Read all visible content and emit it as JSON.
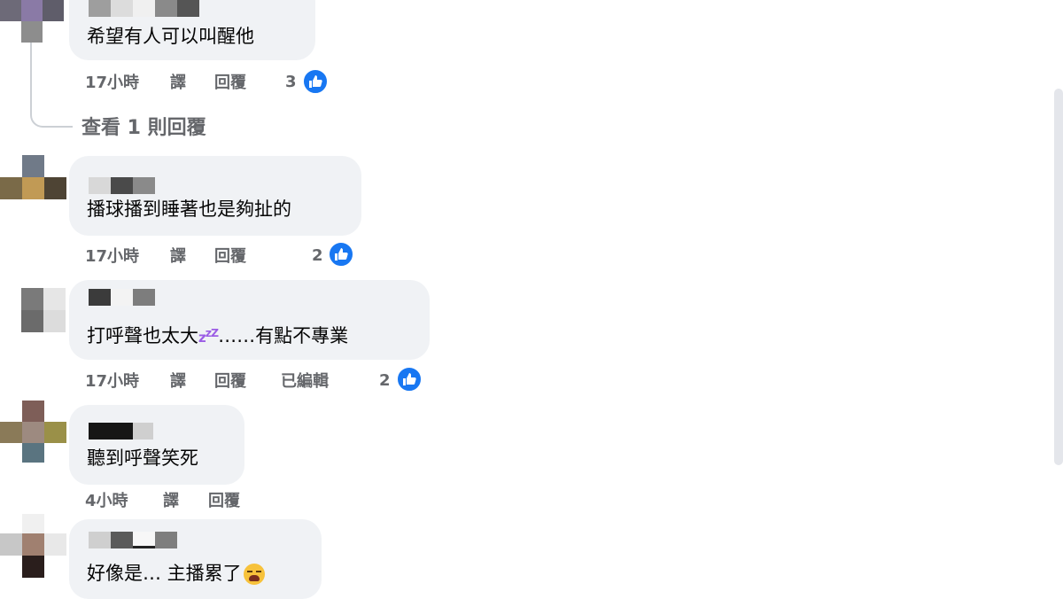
{
  "comments": [
    {
      "text": "希望有人可以叫醒他",
      "time": "17小時",
      "translate": "譯",
      "reply": "回覆",
      "likes": "3",
      "view_replies": "查看 1 則回覆"
    },
    {
      "text": "播球播到睡著也是夠扯的",
      "time": "17小時",
      "translate": "譯",
      "reply": "回覆",
      "likes": "2"
    },
    {
      "text_before": "打呼聲也太大",
      "emoji": "zzz",
      "text_after": "……有點不專業",
      "time": "17小時",
      "translate": "譯",
      "reply": "回覆",
      "edited": "已編輯",
      "likes": "2"
    },
    {
      "text": "聽到呼聲笑死",
      "time": "4小時",
      "translate": "譯",
      "reply": "回覆"
    },
    {
      "text": "好像是… 主播累了",
      "emoji": "weary-face"
    }
  ],
  "colors": {
    "bubble": "#f0f2f5",
    "meta_text": "#65676b",
    "like_blue": "#1877f2"
  },
  "icons": [
    "like-thumb-icon",
    "zzz-emoji",
    "weary-face-emoji"
  ]
}
